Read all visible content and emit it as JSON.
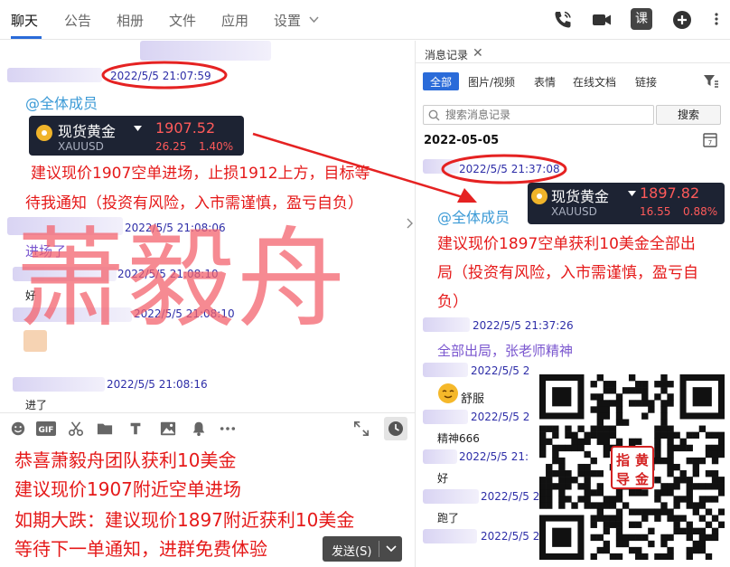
{
  "tabs": [
    "聊天",
    "公告",
    "相册",
    "文件",
    "应用",
    "设置"
  ],
  "header_icons": {
    "phone": "phone-icon",
    "video": "video-icon",
    "course": "课",
    "add": "plus-icon"
  },
  "chat": {
    "ts1": "2022/5/5 21:07:59",
    "at_all": "@全体成员",
    "card1": {
      "name": "现货黄金",
      "code": "XAUUSD",
      "price": "1907.52",
      "change": "26.25",
      "pct": "1.40%"
    },
    "msg1_l1": "建议现价1907空单进场，止损1912上方，目标等",
    "msg1_l2": "待我通知（投资有风险，入市需谨慎，盈亏自负）",
    "ts2": "2022/5/5 21:08:06",
    "msg2": "进场了",
    "ts3": "2022/5/5 21:08:10",
    "msg3": "好",
    "ts4": "2022/5/5 21:08:10",
    "ts5": "2022/5/5 21:08:16",
    "msg5": "进了"
  },
  "watermark": "萧毅舟",
  "composer": {
    "line1": "恭喜萧毅舟团队获利10美金",
    "line2": "建议现价1907附近空单进场",
    "line3": "如期大跌：建议现价1897附近获利10美金",
    "line4": "等待下一单通知，进群免费体验",
    "send_label": "发送(S)"
  },
  "history": {
    "tab_title": "消息记录",
    "filters": [
      "全部",
      "图片/视频",
      "表情",
      "在线文档",
      "链接"
    ],
    "search_placeholder": "搜索消息记录",
    "search_button": "搜索",
    "date": "2022-05-05",
    "ts1": "2022/5/5 21:37:08",
    "card2": {
      "name": "现货黄金",
      "code": "XAUUSD",
      "price": "1897.82",
      "change": "16.55",
      "pct": "0.88%"
    },
    "at_all": "@全体成员",
    "msg1_l1": "建议现价1897空单获利10美金全部出",
    "msg1_l2": "局（投资有风险，入市需谨慎，盈亏自",
    "msg1_l3": "负）",
    "ts2": "2022/5/5 21:37:26",
    "msg2": "全部出局，张老师精神",
    "ts3": "2022/5/5 2",
    "msg3": "舒服",
    "ts4": "2022/5/5 2",
    "msg4": "精神666",
    "ts5": "2022/5/5 21:",
    "msg5": "好",
    "ts6": "2022/5/5 2",
    "msg6": "跑了",
    "ts7": "2022/5/5 2"
  },
  "seal": [
    "指",
    "黄",
    "导",
    "金"
  ],
  "colors": {
    "accent": "#2a6bd9",
    "highlight": "#e51919",
    "watermark": "#f3636d"
  }
}
